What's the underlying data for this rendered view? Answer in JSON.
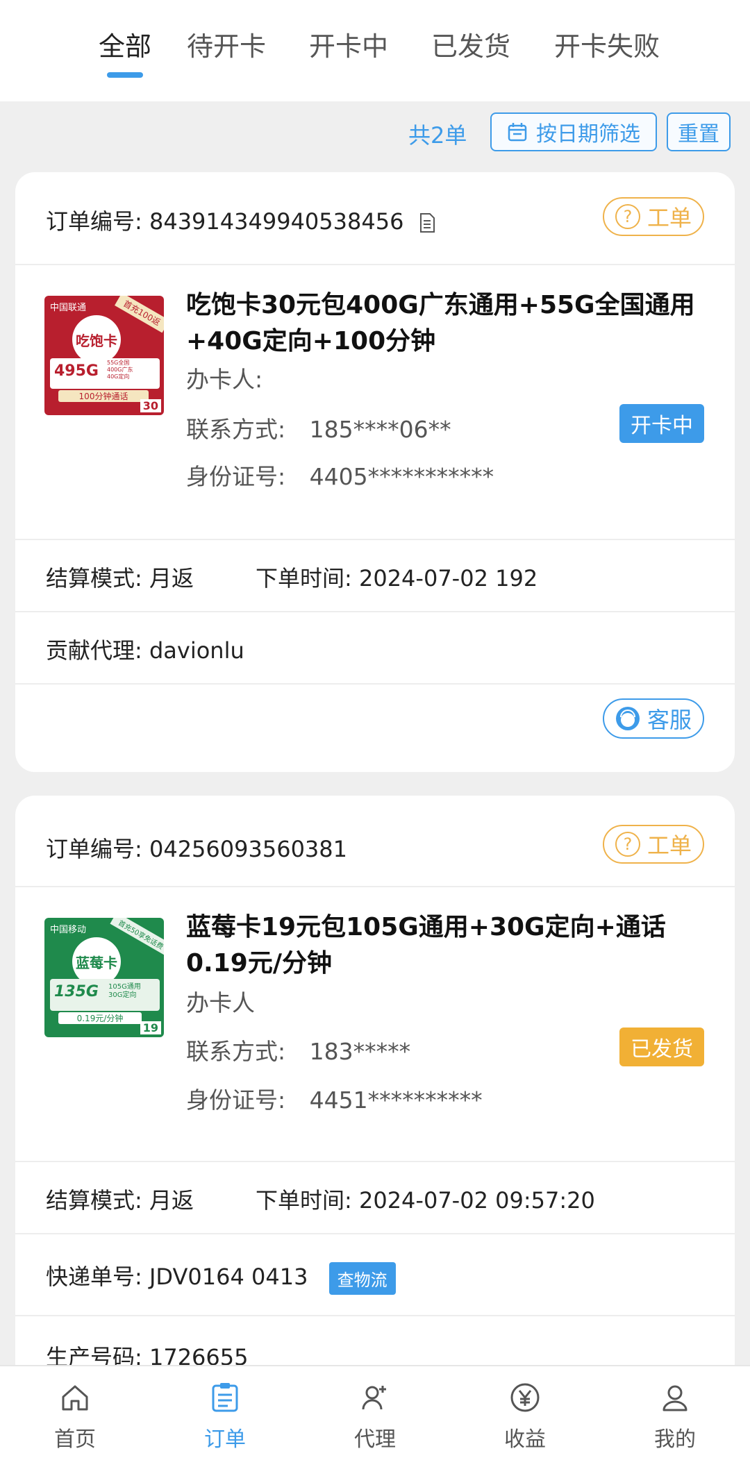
{
  "tabs": [
    {
      "label": "全部",
      "active": true
    },
    {
      "label": "待开卡",
      "active": false
    },
    {
      "label": "开卡中",
      "active": false
    },
    {
      "label": "已发货",
      "active": false
    },
    {
      "label": "开卡失败",
      "active": false
    }
  ],
  "filter": {
    "count": "共2单",
    "date_label": "按日期筛选",
    "reset_label": "重置"
  },
  "orders": [
    {
      "order_label": "订单编号:",
      "order_no": "843914349940538456",
      "ticket_label": "工单",
      "product": {
        "img_brand": "中国联通",
        "img_name": "吃饱卡",
        "img_badge": "首充100返",
        "img_gb": "495G",
        "img_call": "100分钟通话",
        "img_price": "30",
        "img_lines": [
          "55G全国",
          "400G广东",
          "40G定向"
        ],
        "title": "吃饱卡30元包400G广东通用+55G全国通用+40G定向+100分钟"
      },
      "holder_label": "办卡人:",
      "contact_label": "联系方式:",
      "contact_value": "185****06**",
      "id_label": "身份证号:",
      "id_value": "4405***********",
      "status": "开卡中",
      "settle_label": "结算模式:",
      "settle_value": "月返",
      "time_label": "下单时间:",
      "time_value": "2024-07-02 192",
      "agent_label": "贡献代理:",
      "agent_value": "davionlu",
      "service_label": "客服"
    },
    {
      "order_label": "订单编号:",
      "order_no": "04256093560381",
      "ticket_label": "工单",
      "product": {
        "img_brand": "中国移动",
        "img_name": "蓝莓卡",
        "img_badge": "首充50享免话费",
        "img_gb": "135G",
        "img_call": "0.19元/分钟",
        "img_price": "19",
        "img_lines": [
          "105G通用",
          "30G定向"
        ],
        "title": "蓝莓卡19元包105G通用+30G定向+通话0.19元/分钟"
      },
      "holder_label": "办卡人",
      "contact_label": "联系方式:",
      "contact_value": "183*****",
      "id_label": "身份证号:",
      "id_value": "4451**********",
      "status": "已发货",
      "settle_label": "结算模式:",
      "settle_value": "月返",
      "time_label": "下单时间:",
      "time_value": "2024-07-02 09:57:20",
      "express_label": "快递单号:",
      "express_value": "JDV0164 0413",
      "track_label": "查物流",
      "prod_label": "生产号码:",
      "prod_value": "1726655"
    }
  ],
  "nav": [
    {
      "label": "首页",
      "icon": "home-icon",
      "active": false
    },
    {
      "label": "订单",
      "icon": "order-icon",
      "active": true
    },
    {
      "label": "代理",
      "icon": "add-user-icon",
      "active": false
    },
    {
      "label": "收益",
      "icon": "yen-icon",
      "active": false
    },
    {
      "label": "我的",
      "icon": "user-icon",
      "active": false
    }
  ],
  "colors": {
    "accent": "#3d9be9",
    "orange": "#f1b035",
    "ticket": "#efb24a"
  }
}
